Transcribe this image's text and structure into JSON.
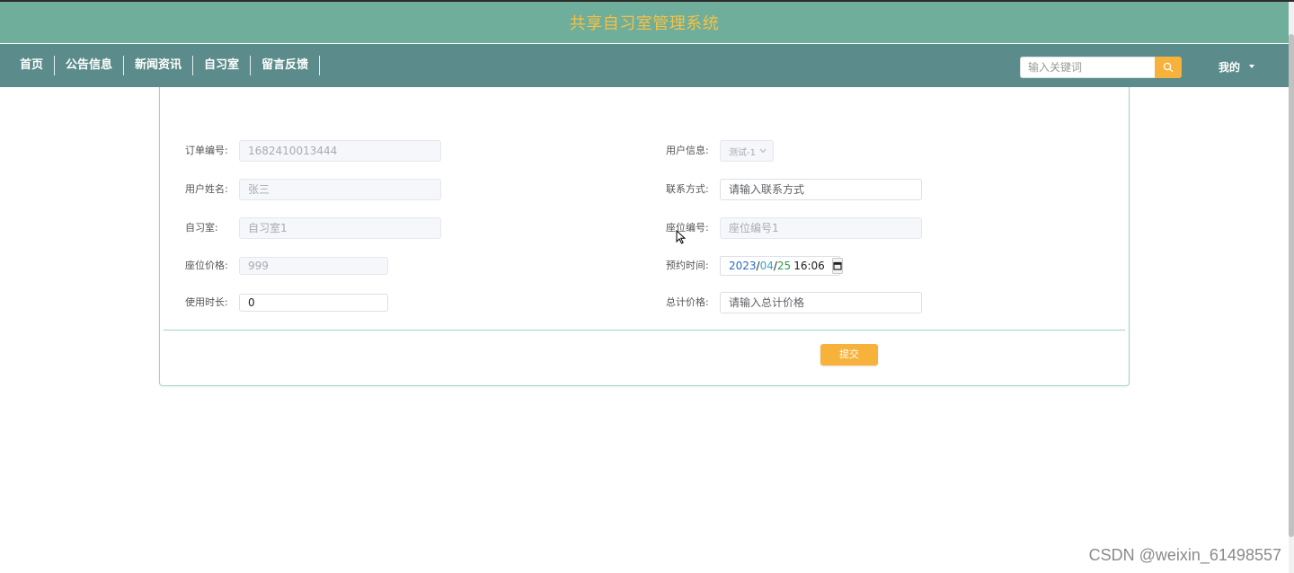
{
  "header": {
    "title": "共享自习室管理系统",
    "title_color": "#f6c244",
    "background": "#6fae9a"
  },
  "nav": {
    "background": "#5b8b8a",
    "items": [
      {
        "label": "首页"
      },
      {
        "label": "公告信息"
      },
      {
        "label": "新闻资讯"
      },
      {
        "label": "自习室"
      },
      {
        "label": "留言反馈"
      }
    ],
    "search": {
      "placeholder": "输入关键词",
      "icon": "search-icon",
      "button_color": "#f7b23b"
    },
    "user_menu": {
      "label": "我的",
      "icon": "caret-down-icon"
    }
  },
  "form": {
    "order_no": {
      "label": "订单编号:",
      "value": "1682410013444"
    },
    "user_info": {
      "label": "用户信息:",
      "value": "测试-1"
    },
    "user_name": {
      "label": "用户姓名:",
      "value": "张三"
    },
    "contact": {
      "label": "联系方式:",
      "placeholder": "请输入联系方式"
    },
    "study_room": {
      "label": "自习室:",
      "value": "自习室1"
    },
    "seat_no": {
      "label": "座位编号:",
      "value": "座位编号1"
    },
    "seat_price": {
      "label": "座位价格:",
      "value": "999"
    },
    "reserve_time": {
      "label": "预约时间:",
      "year": "2023",
      "month": "04",
      "day": "25",
      "time": "16:06",
      "icon": "calendar-icon"
    },
    "duration": {
      "label": "使用时长:",
      "value": "0"
    },
    "total_price": {
      "label": "总计价格:",
      "placeholder": "请输入总计价格"
    },
    "submit": {
      "label": "提交",
      "color": "#f7b23b"
    }
  },
  "watermark": "CSDN @weixin_61498557"
}
